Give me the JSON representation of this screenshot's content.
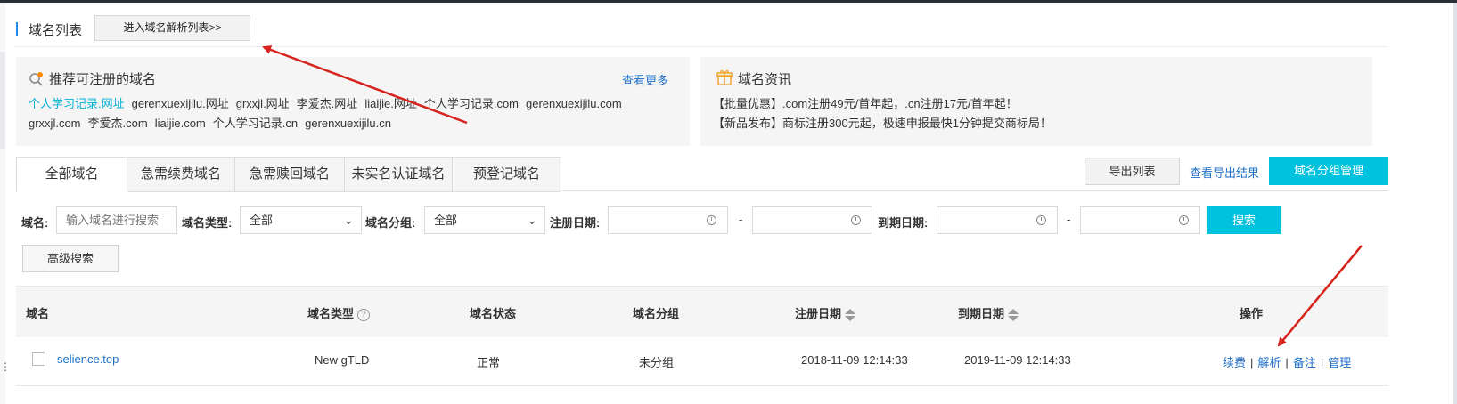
{
  "header": {
    "title": "域名列表",
    "dns_button": "进入域名解析列表>>"
  },
  "recommend": {
    "title": "推荐可注册的域名",
    "more": "查看更多",
    "domains": [
      "个人学习记录.网址",
      "gerenxuexijilu.网址",
      "grxxjl.网址",
      "李爱杰.网址",
      "liaijie.网址",
      "个人学习记录.com",
      "gerenxuexijilu.com",
      "grxxjl.com",
      "李爱杰.com",
      "liaijie.com",
      "个人学习记录.cn",
      "gerenxuexijilu.cn"
    ]
  },
  "news": {
    "title": "域名资讯",
    "items": [
      "【批量优惠】.com注册49元/首年起，.cn注册17元/首年起！",
      "【新品发布】商标注册300元起，极速申报最快1分钟提交商标局！"
    ]
  },
  "tabs": [
    "全部域名",
    "急需续费域名",
    "急需赎回域名",
    "未实名认证域名",
    "预登记域名"
  ],
  "actions": {
    "export": "导出列表",
    "view_export": "查看导出结果",
    "group_manage": "域名分组管理"
  },
  "filters": {
    "domain_label": "域名:",
    "domain_placeholder": "输入域名进行搜索",
    "type_label": "域名类型:",
    "type_value": "全部",
    "group_label": "域名分组:",
    "group_value": "全部",
    "reg_date_label": "注册日期:",
    "exp_date_label": "到期日期:",
    "dash": "-",
    "search": "搜索",
    "advanced": "高级搜索"
  },
  "table": {
    "headers": {
      "domain": "域名",
      "type": "域名类型",
      "status": "域名状态",
      "group": "域名分组",
      "reg_date": "注册日期",
      "exp_date": "到期日期",
      "ops": "操作"
    },
    "rows": [
      {
        "domain": "selience.top",
        "type": "New gTLD",
        "status": "正常",
        "group": "未分组",
        "reg_date": "2018-11-09 12:14:33",
        "exp_date": "2019-11-09 12:14:33",
        "ops": [
          "续费",
          "解析",
          "备注",
          "管理"
        ]
      }
    ]
  },
  "colors": {
    "accent": "#00c1de",
    "link": "#1e6ec8",
    "arrow": "#d6231c",
    "highlight_domain": "#00b0d8"
  },
  "icons": {
    "recommend": "search-icon",
    "news": "gift-icon",
    "help": "help-icon",
    "date": "clock-icon"
  }
}
